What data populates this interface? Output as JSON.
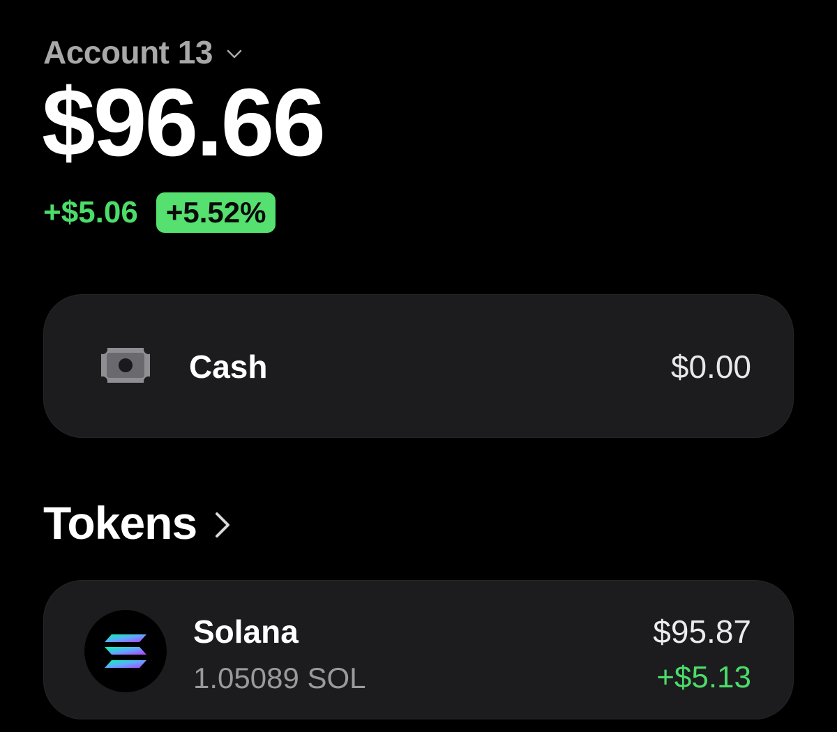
{
  "account": {
    "name": "Account 13",
    "dropdown_icon": "chevron-down-icon"
  },
  "balance": {
    "total": "$96.66",
    "change_amount": "+$5.06",
    "change_percent": "+5.52%"
  },
  "cash": {
    "icon": "cash-icon",
    "label": "Cash",
    "value": "$0.00"
  },
  "tokens": {
    "title": "Tokens",
    "nav_icon": "chevron-right-icon",
    "items": [
      {
        "icon": "solana-logo-icon",
        "name": "Solana",
        "amount": "1.05089 SOL",
        "value": "$95.87",
        "change": "+$5.13"
      }
    ]
  },
  "colors": {
    "background": "#000000",
    "card": "#1c1c1e",
    "positive": "#4bdc6a",
    "badge": "#55e06f",
    "muted_text": "#a8a8a8"
  }
}
